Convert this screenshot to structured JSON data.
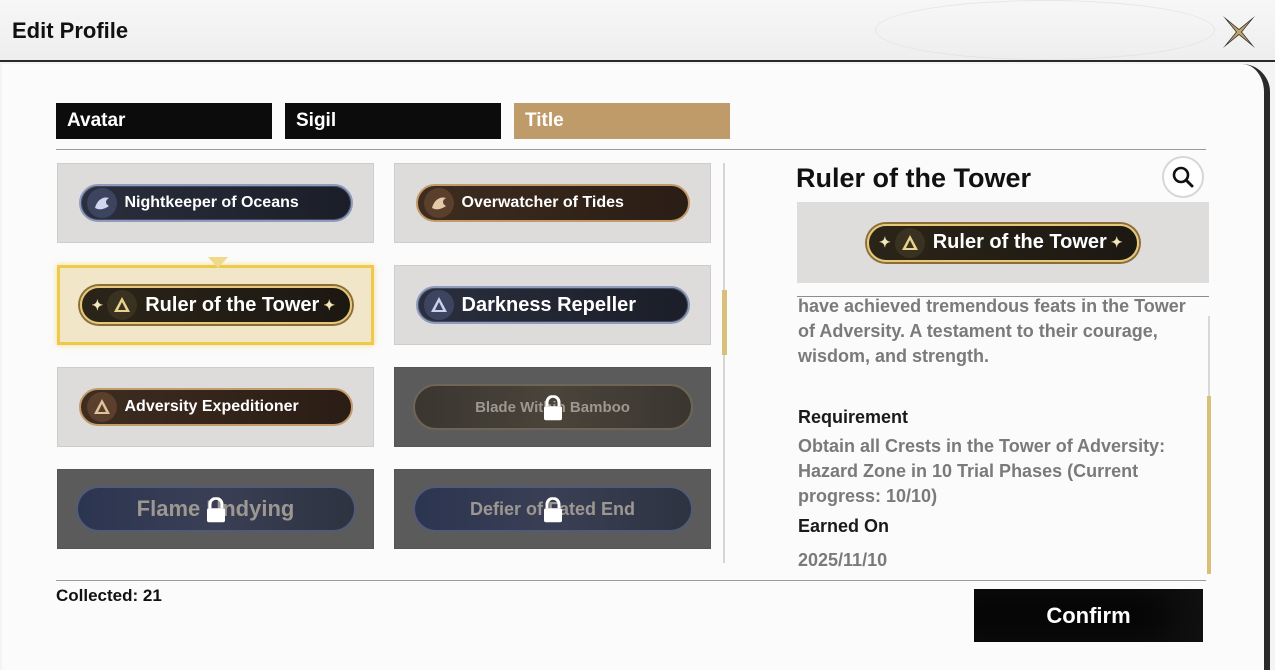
{
  "header": {
    "title": "Edit Profile"
  },
  "tabs": [
    {
      "label": "Avatar",
      "active": false
    },
    {
      "label": "Sigil",
      "active": false
    },
    {
      "label": "Title",
      "active": true
    }
  ],
  "titles": [
    {
      "label": "Nightkeeper of Oceans",
      "style": "dark",
      "locked": false,
      "selected": false
    },
    {
      "label": "Overwatcher of Tides",
      "style": "brown",
      "locked": false,
      "selected": false
    },
    {
      "label": "Ruler of the Tower",
      "style": "gold",
      "locked": false,
      "selected": true
    },
    {
      "label": "Darkness Repeller",
      "style": "dark",
      "locked": false,
      "selected": false
    },
    {
      "label": "Adversity Expeditioner",
      "style": "brown",
      "locked": false,
      "selected": false
    },
    {
      "label": "Blade Within Bamboo",
      "style": "locked",
      "locked": true,
      "selected": false
    },
    {
      "label": "Flame Undying",
      "style": "locked",
      "locked": true,
      "selected": false
    },
    {
      "label": "Defier of Fated End",
      "style": "locked-blue",
      "locked": true,
      "selected": false
    }
  ],
  "detail": {
    "title": "Ruler of the Tower",
    "badge_label": "Ruler of the Tower",
    "description": "have achieved tremendous feats in the Tower of Adversity. A testament to their courage, wisdom, and strength.",
    "requirement_label": "Requirement",
    "requirement_text": "Obtain all Crests in the Tower of Adversity: Hazard Zone in 10 Trial Phases (Current progress: 10/10)",
    "earned_label": "Earned On",
    "earned_value": "2025/11/10"
  },
  "footer": {
    "collected": "Collected: 21",
    "confirm_label": "Confirm"
  },
  "colors": {
    "accent_gold": "#bf9b69",
    "selection": "#f0c84a",
    "scroll_thumb": "#d9c07a"
  }
}
